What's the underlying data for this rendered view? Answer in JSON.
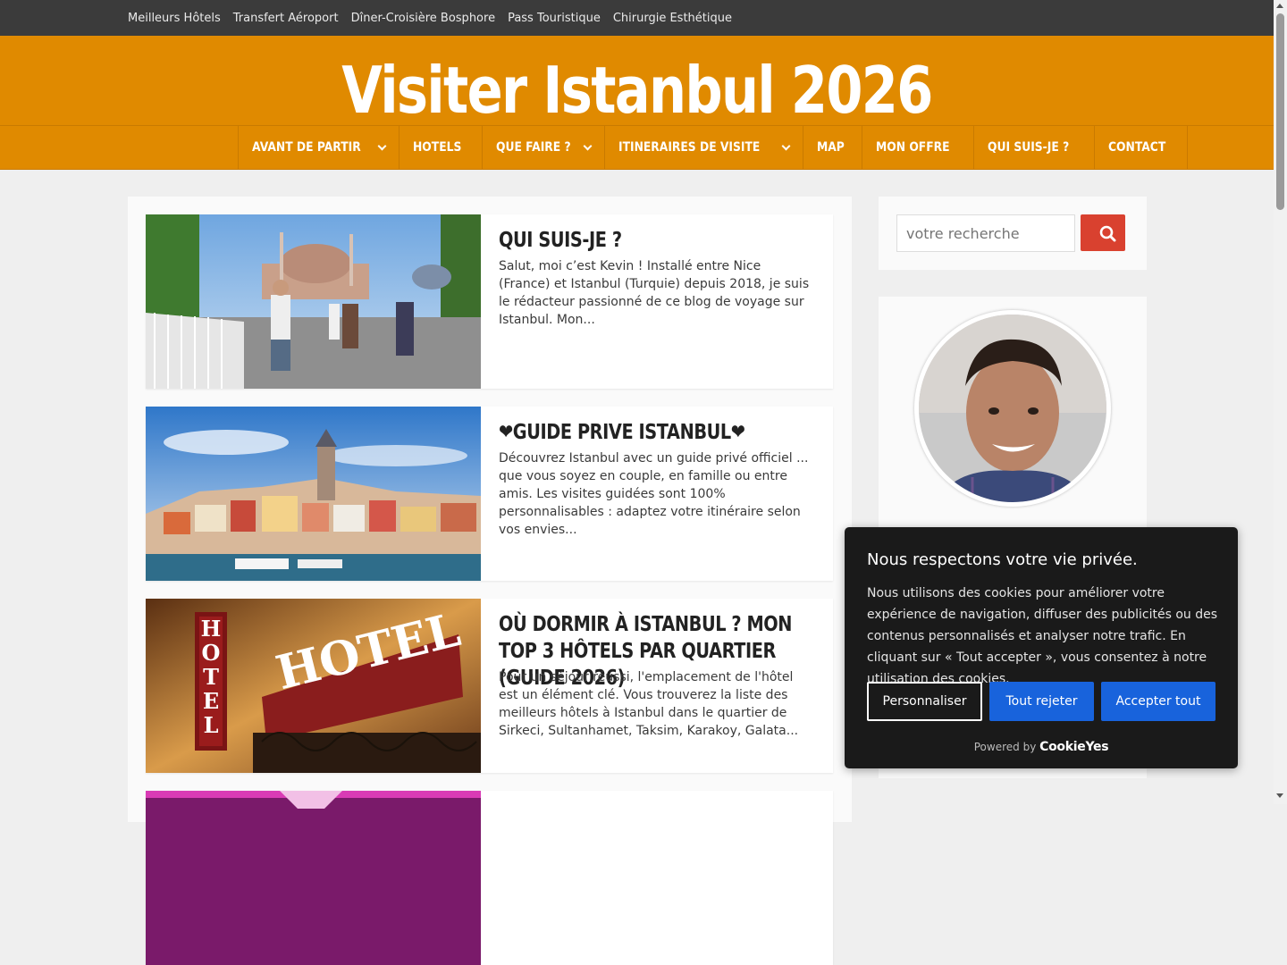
{
  "topbar": {
    "links": [
      "Meilleurs Hôtels",
      "Transfert Aéroport",
      "Dîner-Croisière Bosphore",
      "Pass Touristique",
      "Chirurgie Esthétique"
    ]
  },
  "header": {
    "site_title": "Visiter Istanbul 2026"
  },
  "nav": {
    "items": [
      {
        "label": "AVANT DE PARTIR",
        "dropdown": true
      },
      {
        "label": "HOTELS",
        "dropdown": false
      },
      {
        "label": "QUE FAIRE ?",
        "dropdown": true
      },
      {
        "label": "ITINERAIRES DE VISITE",
        "dropdown": true
      },
      {
        "label": "MAP",
        "dropdown": false
      },
      {
        "label": "MON OFFRE",
        "dropdown": false
      },
      {
        "label": "QUI SUIS-JE ?",
        "dropdown": false
      },
      {
        "label": "CONTACT",
        "dropdown": false
      }
    ]
  },
  "posts": [
    {
      "title": "QUI SUIS-JE ?",
      "excerpt": "Salut, moi c’est Kevin ! Installé entre Nice (France) et Istanbul (Turquie) depuis 2018, je suis le rédacteur passionné de ce blog de voyage sur Istanbul. Mon..."
    },
    {
      "title": "❤GUIDE PRIVE ISTANBUL❤",
      "excerpt": "Découvrez Istanbul avec un guide privé officiel ... que vous soyez en couple, en famille ou entre amis. Les visites guidées sont 100% personnalisables : adaptez votre itinéraire selon vos envies..."
    },
    {
      "title": "OÙ DORMIR À ISTANBUL ? MON TOP 3 HÔTELS PAR QUARTIER (GUIDE 2026)",
      "excerpt": "Pour un séjour réussi, l'emplacement de l'hôtel est un élément clé. Vous trouverez la liste des meilleurs hôtels à Istanbul dans le quartier de Sirkeci, Sultanhamet, Taksim, Karakoy, Galata..."
    }
  ],
  "sidebar": {
    "search_placeholder": "votre recherche"
  },
  "cookie": {
    "title": "Nous respectons votre vie privée.",
    "text": "Nous utilisons des cookies pour améliorer votre expérience de navigation, diffuser des publicités ou des contenus personnalisés et analyser notre trafic. En cliquant sur « Tout accepter », vous consentez à notre utilisation des cookies.",
    "customize": "Personnaliser",
    "reject": "Tout rejeter",
    "accept": "Accepter tout",
    "powered_by": "Powered by",
    "brand": "CookieYes"
  },
  "colors": {
    "header": "#e08a00",
    "topbar": "#3b3b3b",
    "search_button": "#d9412f",
    "cookie_button": "#1863dc"
  }
}
